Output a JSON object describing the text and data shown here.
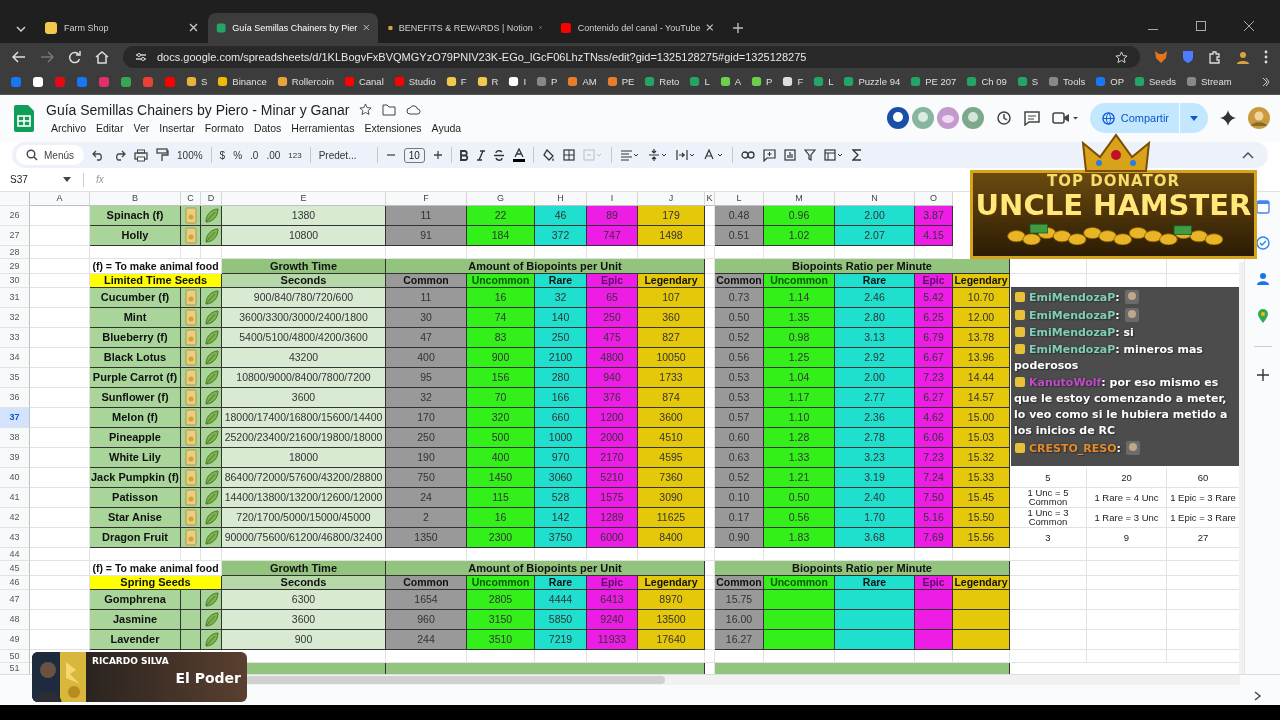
{
  "browser": {
    "tabs": [
      {
        "title": "Farm Shop",
        "selected": false
      },
      {
        "title": "Guía Semillas Chainers by Pier",
        "selected": true
      },
      {
        "title": "BENEFITS & REWARDS | Notion",
        "selected": false
      },
      {
        "title": "Contenido del canal - YouTube",
        "selected": false
      }
    ],
    "url": "docs.google.com/spreadsheets/d/1KLBogvFxBVQMGYzO79PNIV23K-EGo_lGcF06LhzTNss/edit?gid=1325128275#gid=1325128275",
    "bookmarks": [
      "S",
      "Binance",
      "Rollercoin",
      "Canal",
      "Studio",
      "F",
      "R",
      "I",
      "P",
      "AM",
      "PE",
      "Reto",
      "L",
      "A",
      "P",
      "F",
      "L",
      "Puzzle 94",
      "PE 207",
      "Ch 09",
      "S",
      "Tools",
      "OP",
      "Seeds",
      "Stream"
    ]
  },
  "doc": {
    "title": "Guía Semillas Chainers by Piero - Minar y Ganar",
    "menu": [
      "Archivo",
      "Editar",
      "Ver",
      "Insertar",
      "Formato",
      "Datos",
      "Herramientas",
      "Extensiones",
      "Ayuda"
    ],
    "share_label": "Compartir"
  },
  "toolbar": {
    "search": "Menús",
    "zoom": "100%",
    "currency": "$",
    "percent": "%",
    "dec_less": ".0",
    "dec_more": ".00",
    "number_format": "123",
    "font": "Predet...",
    "font_size": "10"
  },
  "formula_bar": {
    "cell": "S37",
    "fx": "fx"
  },
  "sheet": {
    "columns": [
      "A",
      "B",
      "C",
      "D",
      "E",
      "F",
      "G",
      "H",
      "I",
      "J",
      "K",
      "L",
      "M",
      "N",
      "O"
    ],
    "rows": [
      {
        "n": "26",
        "kind": "seed",
        "selected": false,
        "name": "Spinach (f)",
        "seed_pack": true,
        "time": "1380",
        "amounts": [
          "11",
          "22",
          "46",
          "89",
          "179"
        ],
        "ratios": [
          "0.48",
          "0.96",
          "2.00",
          "3.87"
        ]
      },
      {
        "n": "27",
        "kind": "seed",
        "selected": false,
        "name": "Holly",
        "seed_pack": true,
        "time": "10800",
        "amounts": [
          "91",
          "184",
          "372",
          "747",
          "1498"
        ],
        "ratios": [
          "0.51",
          "1.02",
          "2.07",
          "4.15"
        ]
      },
      {
        "n": "28",
        "kind": "blank",
        "selected": false
      },
      {
        "n": "29",
        "kind": "title",
        "selected": false,
        "note": "(f) = To make animal food",
        "growth": "Growth Time",
        "amount": "Amount of Biopoints per Unit",
        "ratio": "Biopoints Ratio per Minute"
      },
      {
        "n": "30",
        "kind": "header",
        "selected": false,
        "category": "Limited Time Seeds",
        "unit": "Seconds",
        "amount_heads": [
          "Common",
          "Uncommon",
          "Rare",
          "Epic",
          "Legendary"
        ],
        "ratio_heads": [
          "Common",
          "Uncommon",
          "Rare",
          "Epic",
          "Legendary"
        ]
      },
      {
        "n": "31",
        "kind": "seed",
        "selected": false,
        "name": "Cucumber (f)",
        "seed_pack": true,
        "time": "900/840/780/720/600",
        "amounts": [
          "11",
          "16",
          "32",
          "65",
          "107"
        ],
        "ratios": [
          "0.73",
          "1.14",
          "2.46",
          "5.42",
          "10.70"
        ]
      },
      {
        "n": "32",
        "kind": "seed",
        "selected": false,
        "name": "Mint",
        "seed_pack": true,
        "time": "3600/3300/3000/2400/1800",
        "amounts": [
          "30",
          "74",
          "140",
          "250",
          "360"
        ],
        "ratios": [
          "0.50",
          "1.35",
          "2.80",
          "6.25",
          "12.00"
        ]
      },
      {
        "n": "33",
        "kind": "seed",
        "selected": false,
        "name": "Blueberry (f)",
        "seed_pack": true,
        "time": "5400/5100/4800/4200/3600",
        "amounts": [
          "47",
          "83",
          "250",
          "475",
          "827"
        ],
        "ratios": [
          "0.52",
          "0.98",
          "3.13",
          "6.79",
          "13.78"
        ]
      },
      {
        "n": "34",
        "kind": "seed",
        "selected": false,
        "name": "Black Lotus",
        "seed_pack": true,
        "time": "43200",
        "amounts": [
          "400",
          "900",
          "2100",
          "4800",
          "10050"
        ],
        "ratios": [
          "0.56",
          "1.25",
          "2.92",
          "6.67",
          "13.96"
        ]
      },
      {
        "n": "35",
        "kind": "seed",
        "selected": false,
        "name": "Purple Carrot (f)",
        "seed_pack": true,
        "time": "10800/9000/8400/7800/7200",
        "amounts": [
          "95",
          "156",
          "280",
          "940",
          "1733"
        ],
        "ratios": [
          "0.53",
          "1.04",
          "2.00",
          "7.23",
          "14.44"
        ]
      },
      {
        "n": "36",
        "kind": "seed",
        "selected": false,
        "name": "Sunflower (f)",
        "seed_pack": true,
        "time": "3600",
        "amounts": [
          "32",
          "70",
          "166",
          "376",
          "874"
        ],
        "ratios": [
          "0.53",
          "1.17",
          "2.77",
          "6.27",
          "14.57"
        ]
      },
      {
        "n": "37",
        "kind": "seed",
        "selected": true,
        "name": "Melon (f)",
        "seed_pack": true,
        "time": "18000/17400/16800/15600/14400",
        "amounts": [
          "170",
          "320",
          "660",
          "1200",
          "3600"
        ],
        "ratios": [
          "0.57",
          "1.10",
          "2.36",
          "4.62",
          "15.00"
        ]
      },
      {
        "n": "38",
        "kind": "seed",
        "selected": false,
        "name": "Pineapple",
        "seed_pack": true,
        "time": "25200/23400/21600/19800/18000",
        "amounts": [
          "250",
          "500",
          "1000",
          "2000",
          "4510"
        ],
        "ratios": [
          "0.60",
          "1.28",
          "2.78",
          "6.06",
          "15.03"
        ]
      },
      {
        "n": "39",
        "kind": "seed",
        "selected": false,
        "name": "White Lily",
        "seed_pack": true,
        "time": "18000",
        "amounts": [
          "190",
          "400",
          "970",
          "2170",
          "4595"
        ],
        "ratios": [
          "0.63",
          "1.33",
          "3.23",
          "7.23",
          "15.32"
        ]
      },
      {
        "n": "40",
        "kind": "seed",
        "selected": false,
        "name": "Jack Pumpkin (f)",
        "seed_pack": true,
        "time": "86400/72000/57600/43200/28800",
        "amounts": [
          "750",
          "1450",
          "3060",
          "5210",
          "7360"
        ],
        "ratios": [
          "0.52",
          "1.21",
          "3.19",
          "7.24",
          "15.33"
        ],
        "extra": [
          "5",
          "20",
          "60"
        ]
      },
      {
        "n": "41",
        "kind": "seed",
        "selected": false,
        "name": "Patisson",
        "seed_pack": true,
        "time": "14400/13800/13200/12600/12000",
        "amounts": [
          "24",
          "115",
          "528",
          "1575",
          "3090"
        ],
        "ratios": [
          "0.10",
          "0.50",
          "2.40",
          "7.50",
          "15.45"
        ],
        "extra": [
          "1 Unc = 5 Common",
          "1 Rare = 4 Unc",
          "1 Epic = 3 Rare"
        ]
      },
      {
        "n": "42",
        "kind": "seed",
        "selected": false,
        "name": "Star Anise",
        "seed_pack": true,
        "time": "720/1700/5000/15000/45000",
        "amounts": [
          "2",
          "16",
          "142",
          "1289",
          "11625"
        ],
        "ratios": [
          "0.17",
          "0.56",
          "1.70",
          "5.16",
          "15.50"
        ],
        "extra": [
          "1 Unc = 3 Common",
          "1 Rare = 3 Unc",
          "1 Epic = 3 Rare"
        ]
      },
      {
        "n": "43",
        "kind": "seed",
        "selected": false,
        "name": "Dragon Fruit",
        "seed_pack": true,
        "time": "90000/75600/61200/46800/32400",
        "amounts": [
          "1350",
          "2300",
          "3750",
          "6000",
          "8400"
        ],
        "ratios": [
          "0.90",
          "1.83",
          "3.68",
          "7.69",
          "15.56"
        ],
        "extra": [
          "3",
          "9",
          "27"
        ]
      },
      {
        "n": "44",
        "kind": "blank",
        "selected": false
      },
      {
        "n": "45",
        "kind": "title",
        "selected": false,
        "note": "(f) = To make animal food",
        "growth": "Growth Time",
        "amount": "Amount of Biopoints per Unit",
        "ratio": "Biopoints Ratio per Minute"
      },
      {
        "n": "46",
        "kind": "header",
        "selected": false,
        "category": "Spring Seeds",
        "unit": "Seconds",
        "amount_heads": [
          "Common",
          "Uncommon",
          "Rare",
          "Epic",
          "Legendary"
        ],
        "ratio_heads": [
          "Common",
          "Uncommon",
          "Rare",
          "Epic",
          "Legendary"
        ]
      },
      {
        "n": "47",
        "kind": "seed",
        "selected": false,
        "name": "Gomphrena",
        "seed_pack": false,
        "time": "6300",
        "amounts": [
          "1654",
          "2805",
          "4444",
          "6413",
          "8970"
        ],
        "ratios": [
          "15.75"
        ]
      },
      {
        "n": "48",
        "kind": "seed",
        "selected": false,
        "name": "Jasmine",
        "seed_pack": false,
        "time": "3600",
        "amounts": [
          "960",
          "3150",
          "5850",
          "9240",
          "13500"
        ],
        "ratios": [
          "16.00"
        ]
      },
      {
        "n": "49",
        "kind": "seed",
        "selected": false,
        "name": "Lavender",
        "seed_pack": false,
        "time": "900",
        "amounts": [
          "244",
          "3510",
          "7219",
          "11933",
          "17640"
        ],
        "ratios": [
          "16.27"
        ]
      },
      {
        "n": "50",
        "kind": "blank",
        "selected": false
      },
      {
        "n": "51",
        "kind": "band",
        "selected": false
      }
    ]
  },
  "overlay": {
    "banner": {
      "heading": "TOP DONATOR",
      "name": "UNCLE HAMSTER"
    },
    "chat": [
      {
        "user": "EmiMendozaP",
        "color": "#7fcfb8",
        "kind": "emote",
        "text": ":"
      },
      {
        "user": "EmiMendozaP",
        "color": "#7fcfb8",
        "kind": "emote",
        "text": ":"
      },
      {
        "user": "EmiMendozaP",
        "color": "#7fcfb8",
        "kind": "text",
        "text": ": si"
      },
      {
        "user": "EmiMendozaP",
        "color": "#7fcfb8",
        "kind": "text",
        "text": ": mineros mas poderosos"
      },
      {
        "user": "KanutoWolf",
        "color": "#c04ac8",
        "kind": "text",
        "text": ": por eso mismo es que le estoy comenzando a meter, lo veo como si le hubiera metido a los inicios de RC"
      },
      {
        "user": "CRESTO_RESO",
        "color": "#e58a2a",
        "kind": "emote",
        "text": ":"
      }
    ],
    "streamer": {
      "name": "RICARDO SILVA",
      "caption": "El Poder"
    }
  }
}
